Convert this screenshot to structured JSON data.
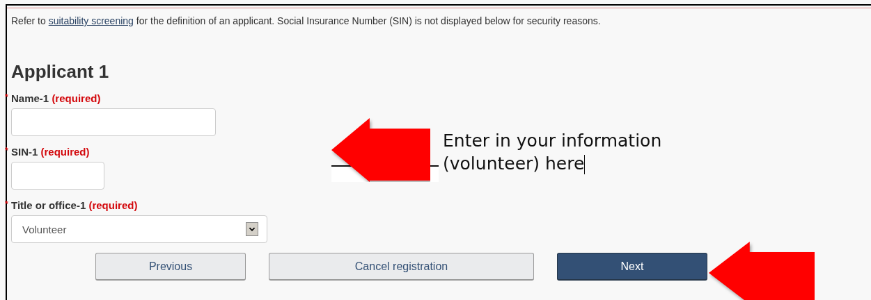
{
  "intro": {
    "before": "Refer to ",
    "link": "suitability screening",
    "after": " for the definition of an applicant. Social Insurance Number (SIN) is not displayed below for security reasons."
  },
  "heading": "Applicant 1",
  "fields": [
    {
      "kind": "text",
      "marker": "*",
      "label": "Name-1",
      "required": "(required)"
    },
    {
      "kind": "short",
      "marker": "*",
      "label": "SIN-1",
      "required": "(required)"
    },
    {
      "kind": "select",
      "marker": "*",
      "label": "Title or office-1",
      "required": "(required)",
      "value": "Volunteer"
    }
  ],
  "buttons": [
    {
      "label": "Previous",
      "kind": "secondary"
    },
    {
      "label": "Cancel registration",
      "kind": "secondary"
    },
    {
      "label": "Next",
      "kind": "primary"
    }
  ],
  "callout": {
    "lines": [
      "Enter in your information",
      "(volunteer) here"
    ]
  }
}
